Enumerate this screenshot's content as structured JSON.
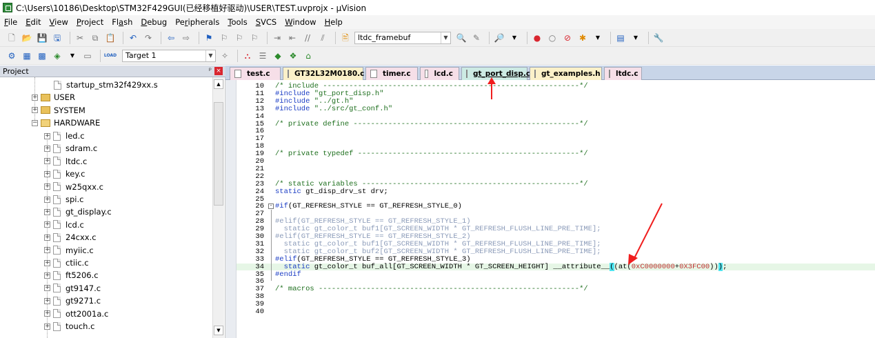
{
  "window": {
    "title": "C:\\Users\\10186\\Desktop\\STM32F429GUI(已经移植好驱动)\\USER\\TEST.uvprojx - µVision"
  },
  "menu": [
    {
      "u": "F",
      "rest": "ile"
    },
    {
      "u": "E",
      "rest": "dit"
    },
    {
      "u": "V",
      "rest": "iew"
    },
    {
      "u": "P",
      "rest": "roject"
    },
    {
      "pre": "Fl",
      "u": "a",
      "rest": "sh"
    },
    {
      "u": "D",
      "rest": "ebug"
    },
    {
      "pre": "Pe",
      "u": "r",
      "rest": "ipherals"
    },
    {
      "u": "T",
      "rest": "ools"
    },
    {
      "u": "S",
      "rest": "VCS"
    },
    {
      "u": "W",
      "rest": "indow"
    },
    {
      "u": "H",
      "rest": "elp"
    }
  ],
  "toolbar1": {
    "combo_value": "ltdc_framebuf"
  },
  "toolbar2": {
    "target": "Target 1",
    "load_label": "LOAD"
  },
  "project": {
    "header": "Project",
    "pin": "ᵖ",
    "close": "×",
    "top_file": "startup_stm32f429xx.s",
    "folders": [
      {
        "name": "USER",
        "expanded": false
      },
      {
        "name": "SYSTEM",
        "expanded": false
      },
      {
        "name": "HARDWARE",
        "expanded": true
      }
    ],
    "files": [
      "led.c",
      "sdram.c",
      "ltdc.c",
      "key.c",
      "w25qxx.c",
      "spi.c",
      "gt_display.c",
      "lcd.c",
      "24cxx.c",
      "myiic.c",
      "ctiic.c",
      "ft5206.c",
      "gt9147.c",
      "gt9271.c",
      "ott2001a.c",
      "touch.c"
    ]
  },
  "tabs": [
    {
      "label": "test.c",
      "style": "pink"
    },
    {
      "label": "GT32L32M0180.c",
      "style": "yellow"
    },
    {
      "label": "timer.c",
      "style": "pink"
    },
    {
      "label": "lcd.c",
      "style": "pink"
    },
    {
      "label": "gt_port_disp.c",
      "style": "active"
    },
    {
      "label": "gt_examples.h",
      "style": "yellow"
    },
    {
      "label": "ltdc.c",
      "style": "pink"
    }
  ],
  "code": [
    {
      "n": "10",
      "segs": [
        {
          "t": "/* include -----------------------------------------------------------*/",
          "c": "c-comment"
        }
      ]
    },
    {
      "n": "11",
      "segs": [
        {
          "t": "#include ",
          "c": "c-pp"
        },
        {
          "t": "\"gt_port_disp.h\"",
          "c": "c-str"
        }
      ]
    },
    {
      "n": "12",
      "segs": [
        {
          "t": "#include ",
          "c": "c-pp"
        },
        {
          "t": "\"../gt.h\"",
          "c": "c-str"
        }
      ]
    },
    {
      "n": "13",
      "segs": [
        {
          "t": "#include ",
          "c": "c-pp"
        },
        {
          "t": "\"../src/gt_conf.h\"",
          "c": "c-str"
        }
      ]
    },
    {
      "n": "14",
      "segs": []
    },
    {
      "n": "15",
      "segs": [
        {
          "t": "/* private define ----------------------------------------------------*/",
          "c": "c-comment"
        }
      ]
    },
    {
      "n": "16",
      "segs": []
    },
    {
      "n": "17",
      "segs": []
    },
    {
      "n": "18",
      "segs": []
    },
    {
      "n": "19",
      "segs": [
        {
          "t": "/* private typedef ---------------------------------------------------*/",
          "c": "c-comment"
        }
      ]
    },
    {
      "n": "20",
      "segs": []
    },
    {
      "n": "21",
      "segs": []
    },
    {
      "n": "22",
      "segs": []
    },
    {
      "n": "23",
      "segs": [
        {
          "t": "/* static variables --------------------------------------------------*/",
          "c": "c-comment"
        }
      ]
    },
    {
      "n": "24",
      "segs": [
        {
          "t": "static",
          "c": "c-kw"
        },
        {
          "t": " gt_disp_drv_st drv;",
          "c": ""
        }
      ]
    },
    {
      "n": "25",
      "segs": []
    },
    {
      "n": "26",
      "fold": "-",
      "segs": [
        {
          "t": "#if",
          "c": "c-pp"
        },
        {
          "t": "(GT_REFRESH_STYLE == GT_REFRESH_STYLE_0)",
          "c": ""
        }
      ]
    },
    {
      "n": "27",
      "segs": []
    },
    {
      "n": "28",
      "segs": [
        {
          "t": "#elif(GT_REFRESH_STYLE == GT_REFRESH_STYLE_1)",
          "c": "c-dim"
        }
      ]
    },
    {
      "n": "29",
      "segs": [
        {
          "t": "  static gt_color_t buf1[GT_SCREEN_WIDTH * GT_REFRESH_FLUSH_LINE_PRE_TIME];",
          "c": "c-dim"
        }
      ]
    },
    {
      "n": "30",
      "segs": [
        {
          "t": "#elif(GT_REFRESH_STYLE == GT_REFRESH_STYLE_2)",
          "c": "c-dim"
        }
      ]
    },
    {
      "n": "31",
      "segs": [
        {
          "t": "  static gt_color_t buf1[GT_SCREEN_WIDTH * GT_REFRESH_FLUSH_LINE_PRE_TIME];",
          "c": "c-dim"
        }
      ]
    },
    {
      "n": "32",
      "segs": [
        {
          "t": "  static gt_color_t buf2[GT_SCREEN_WIDTH * GT_REFRESH_FLUSH_LINE_PRE_TIME];",
          "c": "c-dim"
        }
      ]
    },
    {
      "n": "33",
      "segs": [
        {
          "t": "#elif",
          "c": "c-pp"
        },
        {
          "t": "(GT_REFRESH_STYLE == GT_REFRESH_STYLE_3)",
          "c": ""
        }
      ]
    },
    {
      "n": "34",
      "highlight": true,
      "segs": [
        {
          "t": "  static",
          "c": "c-kw"
        },
        {
          "t": " gt_color_t buf_all[GT_SCREEN_WIDTH * GT_SCREEN_HEIGHT] __attribute__",
          "c": ""
        },
        {
          "t": "(",
          "c": "c-bracket"
        },
        {
          "t": "(at(",
          "c": ""
        },
        {
          "t": "0xC0000000",
          "c": "c-num"
        },
        {
          "t": "+",
          "c": ""
        },
        {
          "t": "0X3FC00",
          "c": "c-num"
        },
        {
          "t": "))",
          "c": ""
        },
        {
          "t": ")",
          "c": "c-bracket"
        },
        {
          "t": ";",
          "c": ""
        }
      ]
    },
    {
      "n": "35",
      "segs": [
        {
          "t": "#endif",
          "c": "c-pp"
        }
      ]
    },
    {
      "n": "36",
      "segs": []
    },
    {
      "n": "37",
      "segs": [
        {
          "t": "/* macros ------------------------------------------------------------*/",
          "c": "c-comment"
        }
      ]
    },
    {
      "n": "38",
      "segs": []
    },
    {
      "n": "39",
      "segs": []
    },
    {
      "n": "40",
      "segs": []
    }
  ],
  "colors": {
    "comment": "#1c6e1c",
    "keyword": "#1a3cc4",
    "inactive": "#8a9ab8",
    "annotation_arrow": "#f01e1e",
    "highlight_line": "#e6f6e6",
    "bracket_match": "#4fe4f0"
  }
}
